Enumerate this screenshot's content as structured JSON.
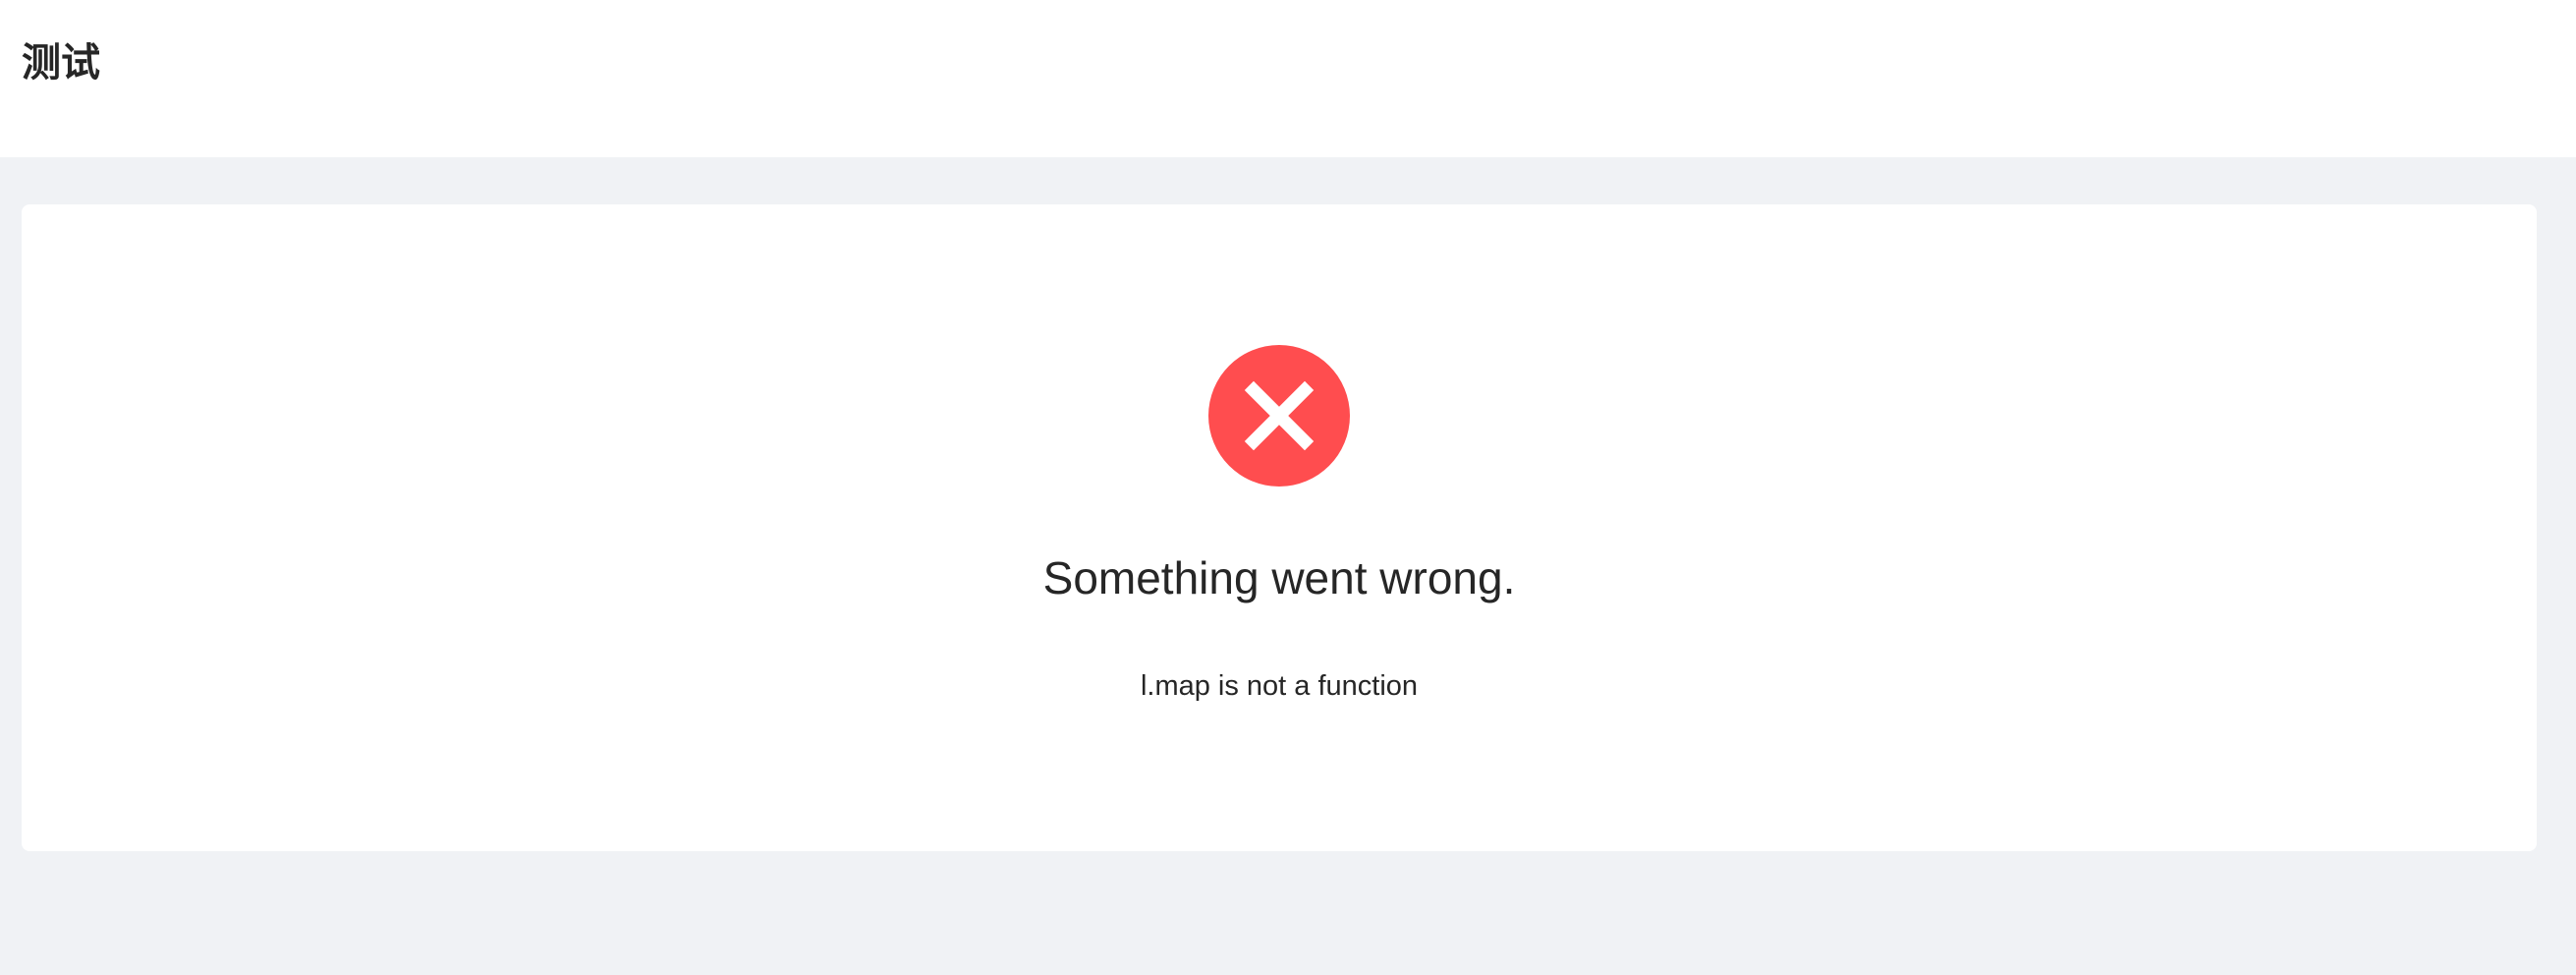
{
  "header": {
    "title": "测试"
  },
  "result": {
    "status": "error",
    "icon": "close-circle-icon",
    "title": "Something went wrong.",
    "subtitle": "l.map is not a function"
  },
  "colors": {
    "error": "#ff4d4f",
    "background": "#f0f2f5",
    "surface": "#ffffff",
    "text": "#262626"
  }
}
